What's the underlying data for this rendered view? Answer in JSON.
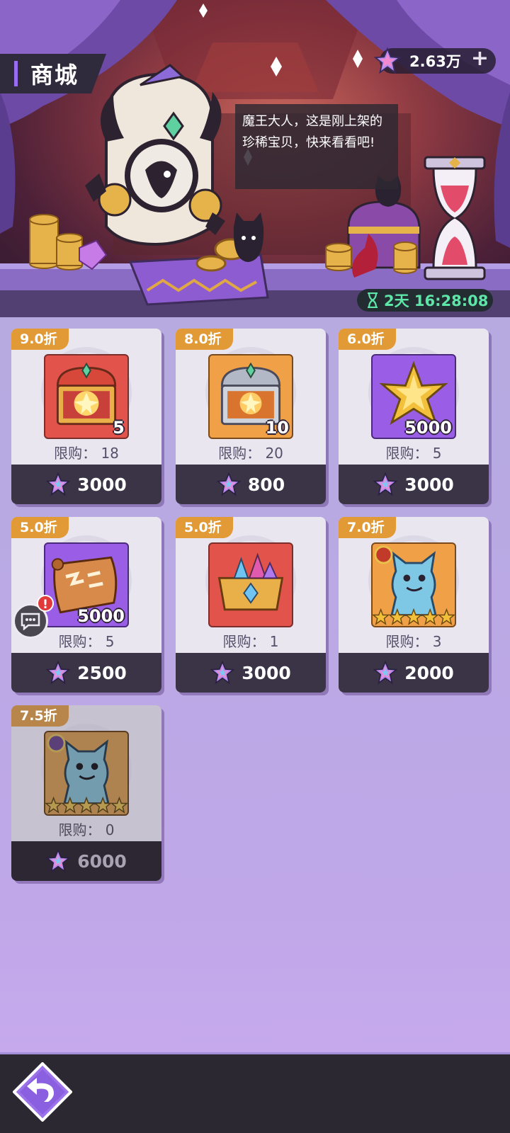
{
  "header": {
    "title": "商城",
    "currency_amount": "2.63万",
    "currency_add_label": "+",
    "speech": "魔王大人，这是刚上架的珍稀宝贝，快来看看吧!",
    "timer": "2天 16:28:08"
  },
  "items": [
    {
      "discount": "9.0折",
      "count": "5",
      "limit": "限购： 18",
      "price": "3000",
      "icon": "red-treasure-chest-icon",
      "frame_color": "#e2544b"
    },
    {
      "discount": "8.0折",
      "count": "10",
      "limit": "限购： 20",
      "price": "800",
      "icon": "silver-treasure-chest-icon",
      "frame_color": "#f0a046"
    },
    {
      "discount": "6.0折",
      "count": "5000",
      "limit": "限购： 5",
      "price": "3000",
      "icon": "gold-star-crystal-icon",
      "frame_color": "#9a5ee6"
    },
    {
      "discount": "5.0折",
      "count": "5000",
      "limit": "限购： 5",
      "price": "2500",
      "icon": "scroll-map-icon",
      "frame_color": "#9a5ee6"
    },
    {
      "discount": "5.0折",
      "count": "",
      "limit": "限购： 1",
      "price": "3000",
      "icon": "gem-crown-chest-icon",
      "frame_color": "#e2544b"
    },
    {
      "discount": "7.0折",
      "count": "",
      "limit": "限购： 3",
      "price": "2000",
      "icon": "blue-cat-monster-icon",
      "frame_color": "#f0a046"
    },
    {
      "discount": "7.5折",
      "count": "",
      "limit": "限购： 0",
      "price": "6000",
      "icon": "blue-cat-monster-icon",
      "frame_color": "#f0a046"
    }
  ],
  "chat_alert": "!",
  "colors": {
    "discount_tag": "#e29a36",
    "timer_text": "#5ee6a8",
    "price_bar": "#3b3446"
  }
}
